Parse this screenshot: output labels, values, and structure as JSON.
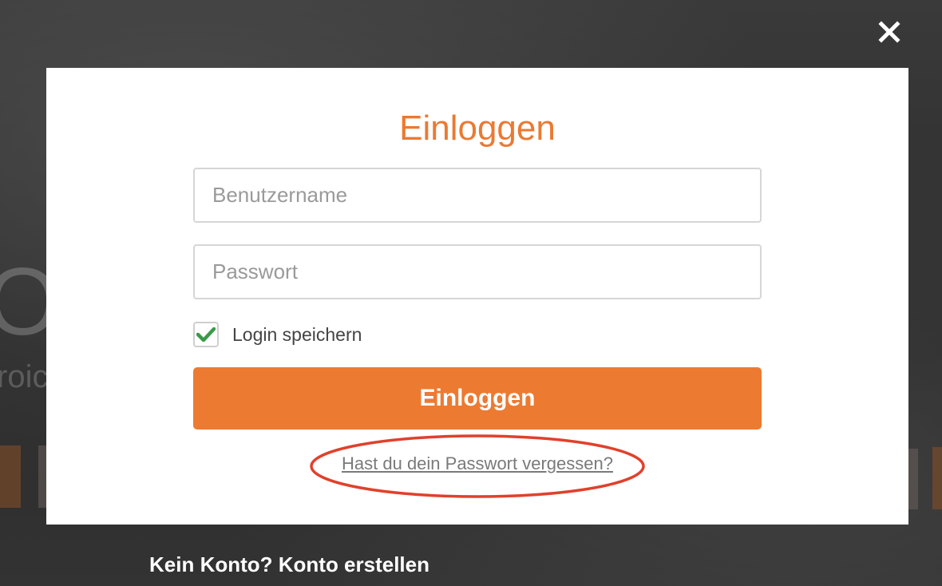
{
  "background": {
    "big_letter": "O",
    "sub_text": "roic"
  },
  "close": {
    "icon": "close-icon",
    "color": "#ffffff"
  },
  "login": {
    "title": "Einloggen",
    "username_placeholder": "Benutzername",
    "password_placeholder": "Passwort",
    "remember_label": "Login speichern",
    "remember_checked": true,
    "submit_label": "Einloggen",
    "forgot_link": "Hast du dein Passwort vergessen?",
    "signup_text": "Kein Konto? Konto erstellen"
  },
  "colors": {
    "accent": "#ea7a32",
    "button": "#ed7a31",
    "annotation": "#e0412c",
    "check": "#3a9a4a"
  }
}
